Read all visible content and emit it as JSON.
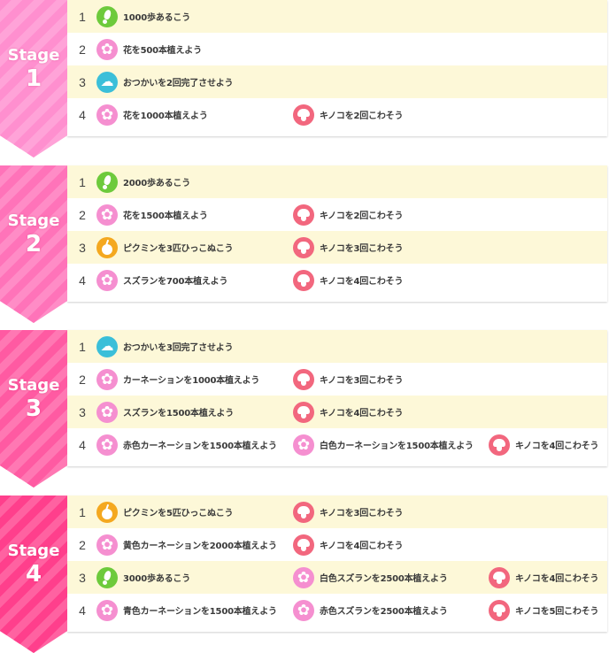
{
  "stage_label": "Stage",
  "colors": {
    "row_highlight": "#fdf8d8",
    "stage_banners": [
      "#ff8fcf",
      "#ff73b9",
      "#ff5aa2",
      "#ff3f8c"
    ],
    "icon_foot": "#6dca3c",
    "icon_flower": "#f58fd0",
    "icon_delivery": "#3bbfd9",
    "icon_pikmin": "#f4a81f",
    "icon_mushroom": "#f2677e"
  },
  "stages": [
    {
      "number": "1",
      "rows": [
        {
          "num": "1",
          "missions": [
            {
              "icon": "foot",
              "text": "1000歩あるこう"
            }
          ]
        },
        {
          "num": "2",
          "missions": [
            {
              "icon": "flower",
              "text": "花を500本植えよう"
            }
          ]
        },
        {
          "num": "3",
          "missions": [
            {
              "icon": "delivery",
              "text": "おつかいを2回完了させよう"
            }
          ]
        },
        {
          "num": "4",
          "missions": [
            {
              "icon": "flower",
              "text": "花を1000本植えよう"
            },
            {
              "icon": "mushroom",
              "text": "キノコを2回こわそう"
            }
          ]
        }
      ]
    },
    {
      "number": "2",
      "rows": [
        {
          "num": "1",
          "missions": [
            {
              "icon": "foot",
              "text": "2000歩あるこう"
            }
          ]
        },
        {
          "num": "2",
          "missions": [
            {
              "icon": "flower",
              "text": "花を1500本植えよう"
            },
            {
              "icon": "mushroom",
              "text": "キノコを2回こわそう"
            }
          ]
        },
        {
          "num": "3",
          "missions": [
            {
              "icon": "pikmin",
              "text": "ピクミンを3匹ひっこぬこう"
            },
            {
              "icon": "mushroom",
              "text": "キノコを3回こわそう"
            }
          ]
        },
        {
          "num": "4",
          "missions": [
            {
              "icon": "flower",
              "text": "スズランを700本植えよう"
            },
            {
              "icon": "mushroom",
              "text": "キノコを4回こわそう"
            }
          ]
        }
      ]
    },
    {
      "number": "3",
      "rows": [
        {
          "num": "1",
          "missions": [
            {
              "icon": "delivery",
              "text": "おつかいを3回完了させよう"
            }
          ]
        },
        {
          "num": "2",
          "missions": [
            {
              "icon": "flower",
              "text": "カーネーションを1000本植えよう"
            },
            {
              "icon": "mushroom",
              "text": "キノコを3回こわそう"
            }
          ]
        },
        {
          "num": "3",
          "missions": [
            {
              "icon": "flower",
              "text": "スズランを1500本植えよう"
            },
            {
              "icon": "mushroom",
              "text": "キノコを4回こわそう"
            }
          ]
        },
        {
          "num": "4",
          "missions": [
            {
              "icon": "flower",
              "text": "赤色カーネーションを1500本植えよう"
            },
            {
              "icon": "flower",
              "text": "白色カーネーションを1500本植えよう"
            },
            {
              "icon": "mushroom",
              "text": "キノコを4回こわそう"
            }
          ]
        }
      ]
    },
    {
      "number": "4",
      "rows": [
        {
          "num": "1",
          "missions": [
            {
              "icon": "pikmin",
              "text": "ピクミンを5匹ひっこぬこう"
            },
            {
              "icon": "mushroom",
              "text": "キノコを3回こわそう"
            }
          ]
        },
        {
          "num": "2",
          "missions": [
            {
              "icon": "flower",
              "text": "黄色カーネーションを2000本植えよう"
            },
            {
              "icon": "mushroom",
              "text": "キノコを4回こわそう"
            }
          ]
        },
        {
          "num": "3",
          "missions": [
            {
              "icon": "foot",
              "text": "3000歩あるこう"
            },
            {
              "icon": "flower",
              "text": "白色スズランを2500本植えよう"
            },
            {
              "icon": "mushroom",
              "text": "キノコを4回こわそう"
            }
          ]
        },
        {
          "num": "4",
          "missions": [
            {
              "icon": "flower",
              "text": "青色カーネーションを1500本植えよう"
            },
            {
              "icon": "flower",
              "text": "赤色スズランを2500本植えよう"
            },
            {
              "icon": "mushroom",
              "text": "キノコを5回こわそう"
            }
          ]
        }
      ]
    }
  ]
}
